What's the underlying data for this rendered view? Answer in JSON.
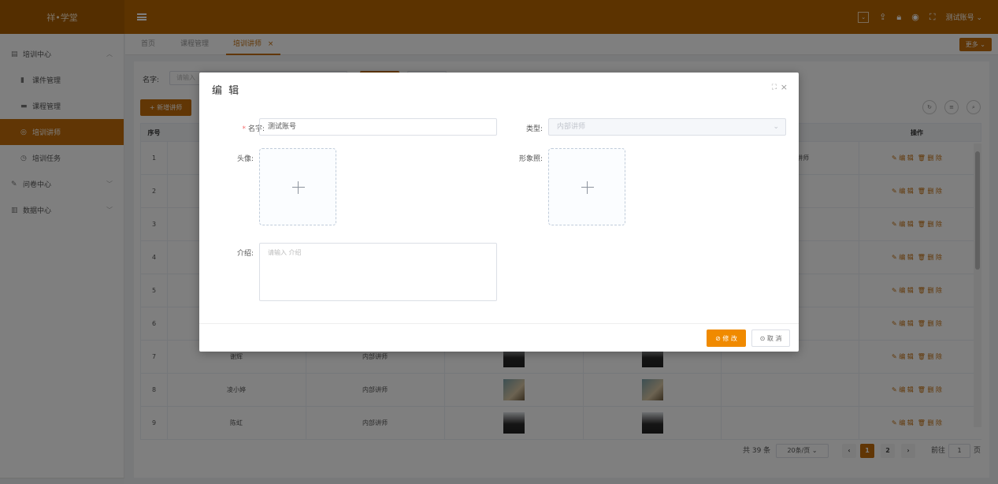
{
  "header": {
    "logo": "祥•学堂",
    "account": "测试账号"
  },
  "sidebar": {
    "items": [
      {
        "label": "培训中心"
      },
      {
        "label": "课件管理"
      },
      {
        "label": "课程管理"
      },
      {
        "label": "培训讲师"
      },
      {
        "label": "培训任务"
      },
      {
        "label": "问卷中心"
      },
      {
        "label": "数据中心"
      }
    ]
  },
  "tabs": [
    "首页",
    "课程管理",
    "培训讲师"
  ],
  "tab_close": "×",
  "more_label": "更多",
  "toolbar": {
    "search_label": "名字:",
    "search_placeholder": "请输入",
    "add_label": "+ 新增讲师"
  },
  "table": {
    "headers": {
      "index": "序号",
      "ops": "操作"
    },
    "rows": [
      {
        "index": "1",
        "name": "",
        "type": "",
        "partial": "讲师"
      },
      {
        "index": "2",
        "name": "",
        "type": "",
        "partial": ""
      },
      {
        "index": "3",
        "name": "",
        "type": "",
        "partial": ""
      },
      {
        "index": "4",
        "name": "",
        "type": "",
        "partial": ""
      },
      {
        "index": "5",
        "name": "",
        "type": "",
        "partial": ""
      },
      {
        "index": "6",
        "name": "",
        "type": "",
        "partial": ""
      },
      {
        "index": "7",
        "name": "谢辉",
        "type": "内部讲师",
        "partial": ""
      },
      {
        "index": "8",
        "name": "凌小婷",
        "type": "内部讲师",
        "partial": ""
      },
      {
        "index": "9",
        "name": "陈虹",
        "type": "内部讲师",
        "partial": ""
      }
    ],
    "edit_label": "✎ 编 辑",
    "delete_label": "🗑 删 除"
  },
  "pagination": {
    "total": "共 39 条",
    "page_size": "20条/页",
    "pages": [
      "1",
      "2"
    ],
    "goto_label": "前往",
    "goto_value": "1",
    "page_suffix": "页"
  },
  "dialog": {
    "title": "编 辑",
    "name_label": "名字:",
    "name_value": "测试账号",
    "type_label": "类型:",
    "type_value": "内部讲师",
    "avatar_label": "头像:",
    "photo_label": "形象照:",
    "intro_label": "介绍:",
    "intro_placeholder": "请输入 介绍",
    "submit_label": "⊘ 修 改",
    "cancel_label": "⊙ 取 消"
  },
  "colors": {
    "accent": "#c36d0a",
    "header": "#b96600",
    "primary_button": "#f08a00"
  }
}
